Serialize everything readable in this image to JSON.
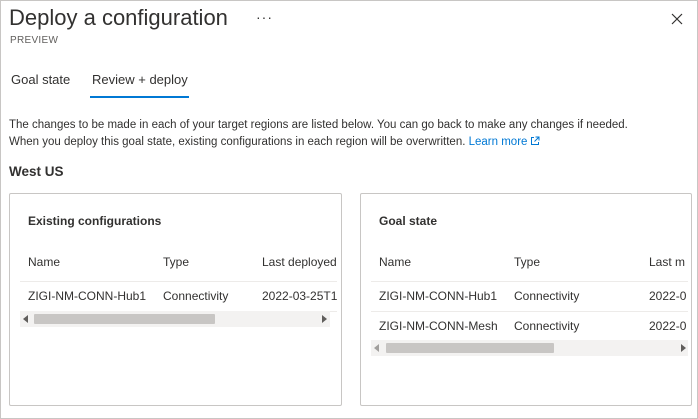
{
  "blade": {
    "title": "Deploy a configuration",
    "subtitle": "PREVIEW",
    "more_label": "···",
    "close_icon": "close-icon"
  },
  "tabs": [
    {
      "label": "Goal state",
      "selected": false
    },
    {
      "label": "Review + deploy",
      "selected": true
    }
  ],
  "accent_color": "#0078d4",
  "description": {
    "line1": "The changes to be made in each of your target regions are listed below. You can go back to make any changes if needed.",
    "line2": "When you deploy this goal state, existing configurations in each region will be overwritten.",
    "link": "Learn more",
    "link_icon": "external-link-icon"
  },
  "region": "West US",
  "existing": {
    "title": "Existing configurations",
    "columns": [
      "Name",
      "Type",
      "Last deployed"
    ],
    "rows": [
      [
        "ZIGI-NM-CONN-Hub1",
        "Connectivity",
        "2022-03-25T1"
      ]
    ]
  },
  "goal": {
    "title": "Goal state",
    "columns": [
      "Name",
      "Type",
      "Last m"
    ],
    "rows": [
      [
        "ZIGI-NM-CONN-Hub1",
        "Connectivity",
        "2022-0"
      ],
      [
        "ZIGI-NM-CONN-Mesh",
        "Connectivity",
        "2022-0"
      ]
    ]
  }
}
